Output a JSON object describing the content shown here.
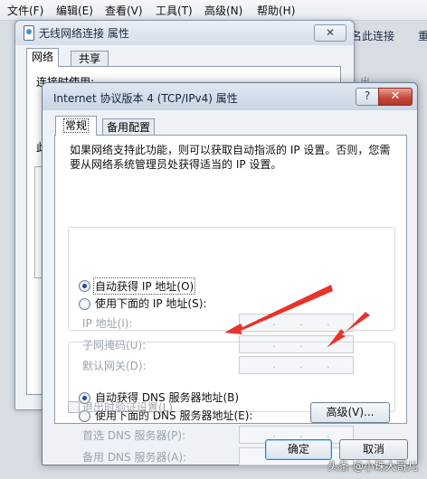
{
  "explorer": {
    "menu": [
      "文件(F)",
      "编辑(E)",
      "查看(V)",
      "工具(T)",
      "高级(N)",
      "帮助(H)"
    ],
    "command_disconnect": "名此连接",
    "command_trunc": "重",
    "right_hint": "出"
  },
  "back_dialog": {
    "title": "无线网络连接 属性",
    "close_glyph": "✕",
    "tabs": [
      "网络",
      "共享"
    ],
    "connect_label": "连接时使用:",
    "stub": "此"
  },
  "dialog": {
    "title": "Internet 协议版本 4 (TCP/IPv4) 属性",
    "help_glyph": "?",
    "close_glyph": "✕",
    "tabs": [
      "常规",
      "备用配置"
    ],
    "description": "如果网络支持此功能，则可以获取自动指派的 IP 设置。否则，您需要从网络系统管理员处获得适当的 IP 设置。",
    "ip": {
      "auto_label": "自动获得 IP 地址(O)",
      "manual_label": "使用下面的 IP 地址(S):",
      "auto_selected": true,
      "fields": [
        {
          "label": "IP 地址(I):",
          "value": ". . ."
        },
        {
          "label": "子网掩码(U):",
          "value": ". . ."
        },
        {
          "label": "默认网关(D):",
          "value": ". . ."
        }
      ]
    },
    "dns": {
      "auto_label": "自动获得 DNS 服务器地址(B)",
      "manual_label": "使用下面的 DNS 服务器地址(E):",
      "auto_selected": true,
      "fields": [
        {
          "label": "首选 DNS 服务器(P):",
          "value": ". . ."
        },
        {
          "label": "备用 DNS 服务器(A):",
          "value": ". . ."
        }
      ]
    },
    "validate_label": "退出时验证设置(L)",
    "advanced_button": "高级(V)...",
    "ok_button": "确定",
    "cancel_button": "取消"
  },
  "annotation": {
    "arrow_color": "#e8322a"
  },
  "watermark": "头条 @小珠大哥儿"
}
